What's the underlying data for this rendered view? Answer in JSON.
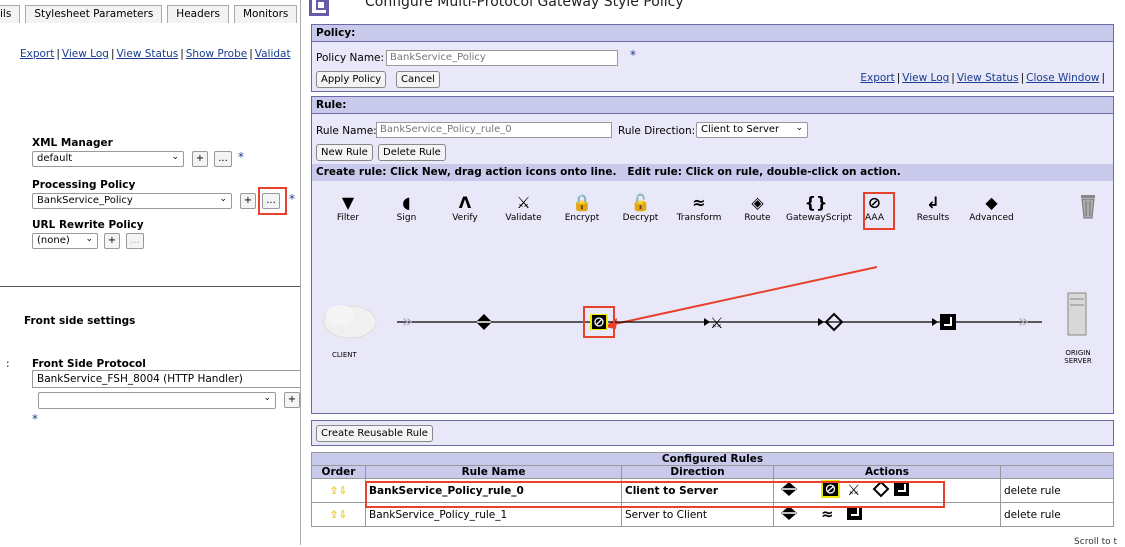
{
  "left": {
    "tabs": [
      "ils",
      "Stylesheet Parameters",
      "Headers",
      "Monitors"
    ],
    "links": [
      "Export",
      "View Log",
      "View Status",
      "Show Probe",
      "Validat"
    ],
    "xml_manager": {
      "label": "XML Manager",
      "value": "default"
    },
    "processing_policy": {
      "label": "Processing Policy",
      "value": "BankService_Policy"
    },
    "url_rewrite": {
      "label": "URL Rewrite Policy",
      "value": "(none)"
    },
    "plus": "+",
    "ellipsis": "...",
    "star": "*",
    "front_side_settings": "Front side settings",
    "front_side_protocol": {
      "label": "Front Side Protocol",
      "value": "BankService_FSH_8004 (HTTP Handler)"
    },
    "colon": ":"
  },
  "right": {
    "window_title": "Configure Multi-Protocol Gateway Style Policy",
    "policy": {
      "header": "Policy:",
      "name_label": "Policy Name:",
      "name_value": "BankService_Policy",
      "apply_button": "Apply Policy",
      "cancel_button": "Cancel",
      "links": [
        "Export",
        "View Log",
        "View Status",
        "Close Window"
      ]
    },
    "rule": {
      "header": "Rule:",
      "name_label": "Rule Name:",
      "name_value": "BankService_Policy_rule_0",
      "direction_label": "Rule Direction:",
      "direction_value": "Client to Server",
      "new_button": "New Rule",
      "delete_button": "Delete Rule",
      "instructions": "Create rule: Click New, drag action icons onto line.   Edit rule: Click on rule, double-click on action."
    },
    "palette": [
      {
        "label": "Filter",
        "icon": "filter-icon",
        "glyph": "▼"
      },
      {
        "label": "Sign",
        "icon": "sign-icon",
        "glyph": "◖"
      },
      {
        "label": "Verify",
        "icon": "verify-icon",
        "glyph": "Λ"
      },
      {
        "label": "Validate",
        "icon": "validate-icon",
        "glyph": "⚔"
      },
      {
        "label": "Encrypt",
        "icon": "encrypt-icon",
        "glyph": "🔒"
      },
      {
        "label": "Decrypt",
        "icon": "decrypt-icon",
        "glyph": "🔓"
      },
      {
        "label": "Transform",
        "icon": "transform-icon",
        "glyph": "≈"
      },
      {
        "label": "Route",
        "icon": "route-icon",
        "glyph": "◈"
      },
      {
        "label": "GatewayScript",
        "icon": "gatewayscript-icon",
        "glyph": "{}"
      },
      {
        "label": "AAA",
        "icon": "aaa-icon",
        "glyph": "⊘"
      },
      {
        "label": "Results",
        "icon": "results-icon",
        "glyph": "↲"
      },
      {
        "label": "Advanced",
        "icon": "advanced-icon",
        "glyph": "◆"
      }
    ],
    "client_label": "CLIENT",
    "origin_label": "ORIGIN SERVER",
    "create_reusable": "Create Reusable Rule",
    "configured": {
      "title": "Configured Rules",
      "columns": [
        "Order",
        "Rule Name",
        "Direction",
        "Actions",
        ""
      ],
      "rows": [
        {
          "name": "BankService_Policy_rule_0",
          "direction": "Client to Server",
          "delete": "delete rule"
        },
        {
          "name": "BankService_Policy_rule_1",
          "direction": "Server to Client",
          "delete": "delete rule"
        }
      ]
    },
    "footer_text": "Scroll to t",
    "accent": "#e8412c",
    "header_bg": "#c9c9ec",
    "panel_bg": "#e8e8f8"
  }
}
